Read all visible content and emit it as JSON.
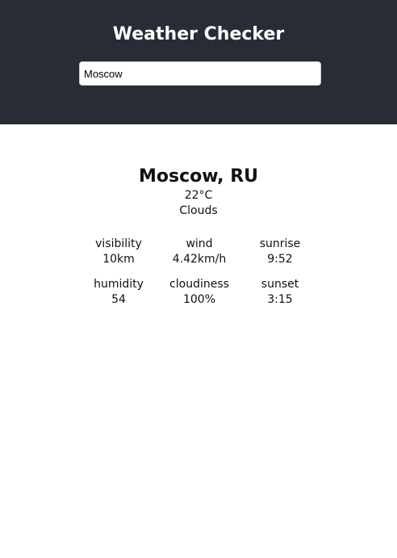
{
  "header": {
    "title": "Weather Checker",
    "search_value": "Moscow"
  },
  "weather": {
    "location": "Moscow, RU",
    "temperature": "22°C",
    "condition": "Clouds",
    "stats": [
      {
        "label": "visibility",
        "value": "10km"
      },
      {
        "label": "wind",
        "value": "4.42km/h"
      },
      {
        "label": "sunrise",
        "value": "9:52"
      },
      {
        "label": "humidity",
        "value": "54"
      },
      {
        "label": "cloudiness",
        "value": "100%"
      },
      {
        "label": "sunset",
        "value": "3:15"
      }
    ]
  },
  "colors": {
    "header_bg": "#282c34",
    "header_text": "#ffffff"
  }
}
